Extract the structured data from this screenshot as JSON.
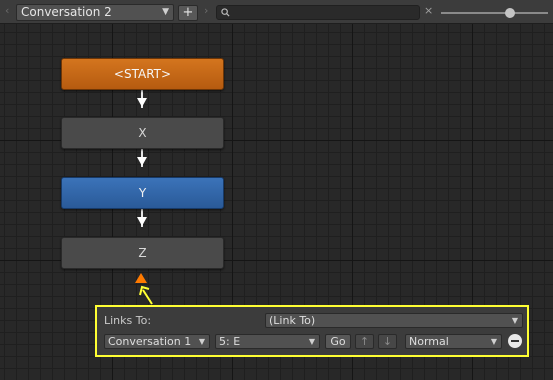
{
  "toolbar": {
    "conversation": "Conversation 2",
    "add_label": "+",
    "search_value": "",
    "clear_label": "×",
    "nav_left": "‹",
    "nav_right": "›",
    "zoom_fraction": 0.6
  },
  "nodes": {
    "start": "<START>",
    "x": "X",
    "y": "Y",
    "z": "Z"
  },
  "links_panel": {
    "links_to_label": "Links To:",
    "links_to_value": "(Link To)",
    "conversation_value": "Conversation 1",
    "entry_value": "5: E",
    "go_label": "Go",
    "up_label": "↑",
    "down_label": "↓",
    "priority_value": "Normal"
  },
  "colors": {
    "start_node": "#c8691a",
    "selected_node": "#3268ad",
    "default_node": "#4a4a4a",
    "highlight_border": "#ffff33",
    "orange_marker": "#ff7a00"
  }
}
